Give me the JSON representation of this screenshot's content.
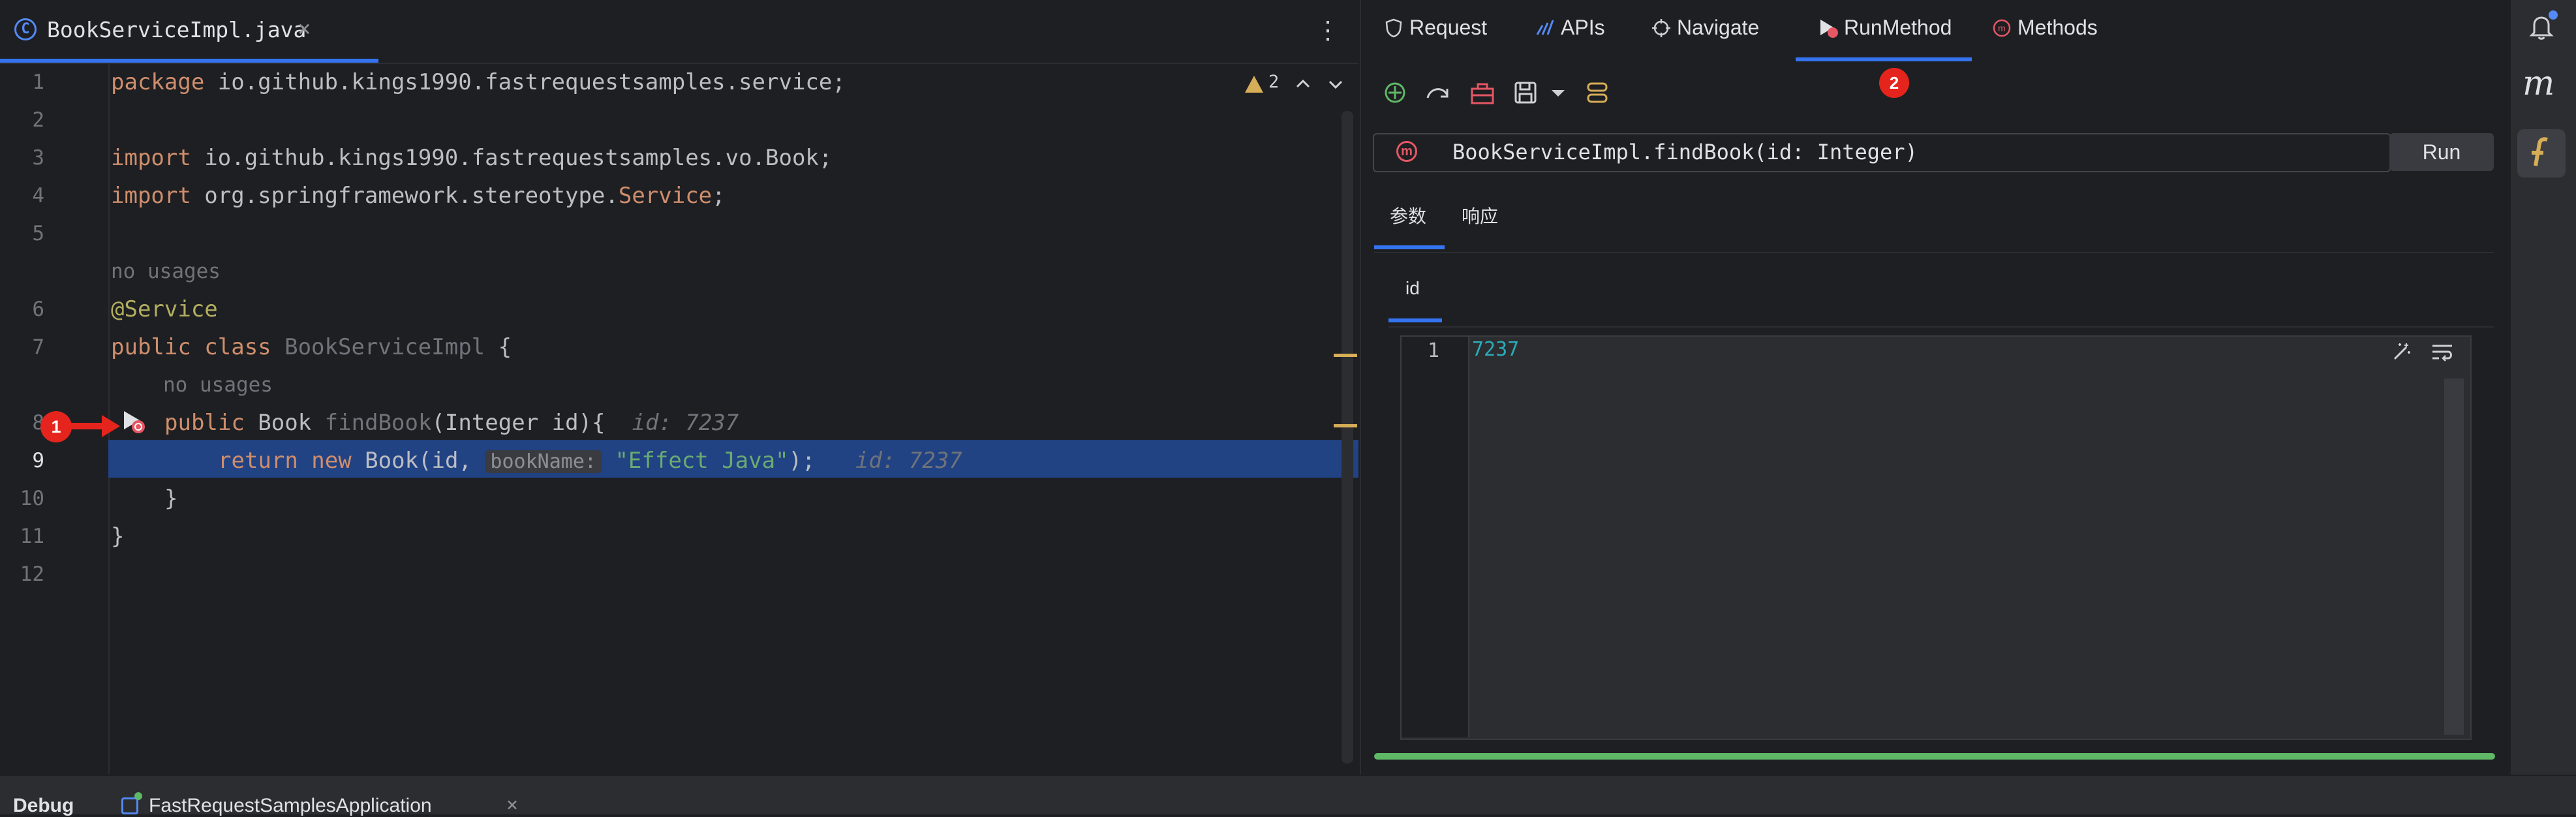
{
  "editor": {
    "tab": {
      "file_name": "BookServiceImpl.java",
      "icon": "class-icon",
      "close": "×"
    },
    "more_menu": "⋮",
    "warnings": {
      "count": "2"
    },
    "line_numbers": [
      "1",
      "2",
      "3",
      "4",
      "5",
      "6",
      "7",
      "8",
      "9",
      "10",
      "11",
      "12"
    ],
    "current_line": "9",
    "code": {
      "l1_kw": "package",
      "l1_rest": " io.github.kings1990.fastrequestsamples.service;",
      "l3_kw": "import",
      "l3_rest": " io.github.kings1990.fastrequestsamples.vo.Book;",
      "l4_kw": "import",
      "l4_rest": " org.springframework.stereotype.",
      "l4_svc": "Service",
      "l4_end": ";",
      "usage1": "no usages",
      "l6": "@Service",
      "l7_kw": "public class",
      "l7_cls": " BookServiceImpl",
      "l7_end": " {",
      "usage2": "no usages",
      "l8_kw": "public",
      "l8_type": " Book ",
      "l8_fn": "findBook",
      "l8_params": "(Integer id){",
      "l8_hint": "id: 7237",
      "l9_kw": "return new",
      "l9_call": " Book(id, ",
      "l9_inlay": "bookName:",
      "l9_str": "\"Effect Java\"",
      "l9_end": ");",
      "l9_hint": "id: 7237",
      "l10": "}",
      "l11": "}"
    }
  },
  "tool_window": {
    "tabs": [
      "Request",
      "APIs",
      "Navigate",
      "RunMethod",
      "Methods"
    ],
    "active_tab": "RunMethod",
    "method_signature": "BookServiceImpl.findBook(id: Integer)",
    "run_label": "Run",
    "sub_tabs": [
      "参数",
      "响应"
    ],
    "param_tabs": [
      "id"
    ],
    "json_editor": {
      "line": "1",
      "value": "7237"
    }
  },
  "annotations": {
    "one": "1",
    "two": "2"
  },
  "bottom": {
    "debug_label": "Debug",
    "app_label": "FastRequestSamplesApplication",
    "close": "×"
  },
  "colors": {
    "accent": "#3574f0",
    "highlight": "#214283",
    "progress": "#5fb865",
    "annotation": "#e5251d"
  }
}
